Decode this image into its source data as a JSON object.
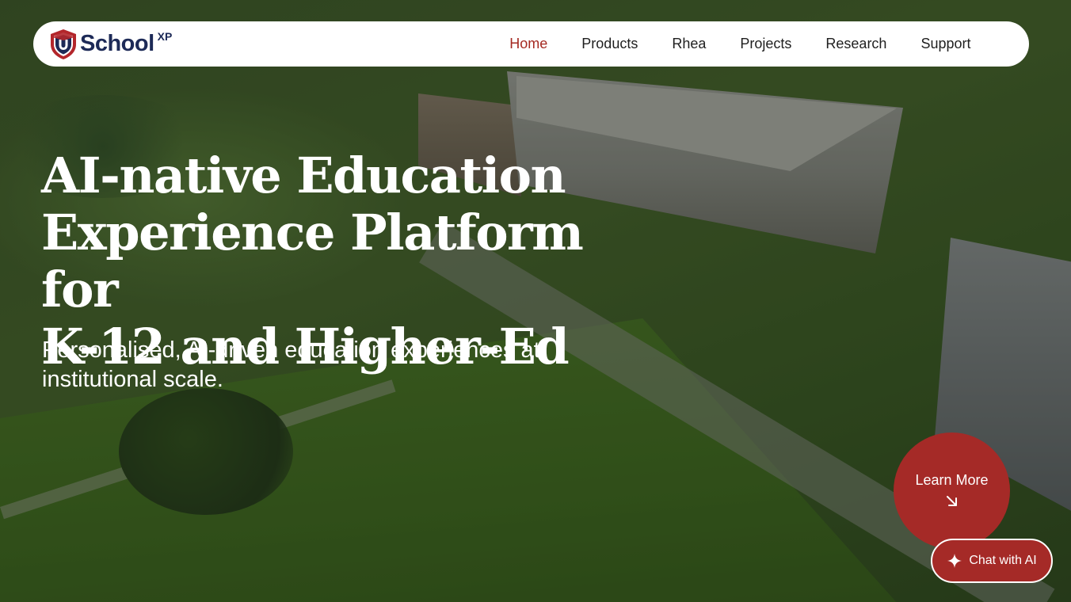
{
  "brand": {
    "name": "School",
    "superscript": "XP",
    "logo_icon": "shield-u-icon",
    "colors": {
      "navy": "#1d2a57",
      "red": "#a52a22"
    }
  },
  "nav": {
    "items": [
      {
        "label": "Home",
        "active": true
      },
      {
        "label": "Products",
        "active": false
      },
      {
        "label": "Rhea",
        "active": false
      },
      {
        "label": "Projects",
        "active": false
      },
      {
        "label": "Research",
        "active": false
      },
      {
        "label": "Support",
        "active": false
      }
    ],
    "active_color": "#a52a22"
  },
  "hero": {
    "headline_lines": [
      "AI-native Education",
      "Experience Platform for",
      "K-12 and Higher-Ed"
    ],
    "subheadline_lines": [
      "Personalised, AI-driven education experiences at",
      "institutional scale."
    ]
  },
  "cta": {
    "learn_more_label": "Learn More",
    "learn_more_icon": "arrow-down-right-icon",
    "chat_label": "Chat with AI",
    "chat_icon": "sparkle-icon",
    "accent_color": "#a52a27"
  }
}
